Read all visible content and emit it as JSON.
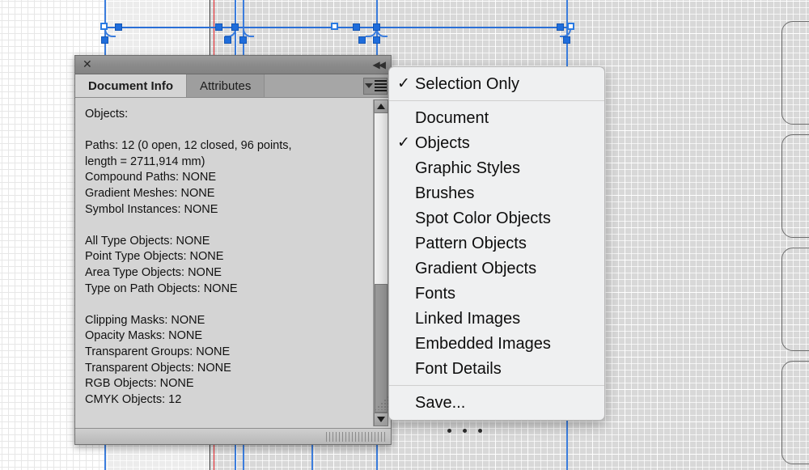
{
  "app": {
    "canvas_label": "illustrator-artboard"
  },
  "panel": {
    "title_close_icon": "✕",
    "collapse_icon": "◀◀",
    "tabs": [
      {
        "label": "Document Info",
        "active": true
      },
      {
        "label": "Attributes",
        "active": false
      }
    ],
    "menu_button_name": "panel-menu-icon",
    "info_text": "Objects:\n\nPaths: 12 (0 open, 12 closed, 96 points,\nlength = 2711,914 mm)\nCompound Paths: NONE\nGradient Meshes: NONE\nSymbol Instances: NONE\n\nAll Type Objects: NONE\nPoint Type Objects: NONE\nArea Type Objects: NONE\nType on Path Objects: NONE\n\nClipping Masks: NONE\nOpacity Masks: NONE\nTransparent Groups: NONE\nTransparent Objects: NONE\nRGB Objects: NONE\nCMYK Objects: 12",
    "scroll": {
      "up_arrow": "▲",
      "down_arrow": "▼"
    }
  },
  "menu": {
    "groups": [
      {
        "items": [
          {
            "label": "Selection Only",
            "checked": true
          }
        ]
      },
      {
        "items": [
          {
            "label": "Document",
            "checked": false
          },
          {
            "label": "Objects",
            "checked": true
          },
          {
            "label": "Graphic Styles",
            "checked": false
          },
          {
            "label": "Brushes",
            "checked": false
          },
          {
            "label": "Spot Color Objects",
            "checked": false
          },
          {
            "label": "Pattern Objects",
            "checked": false
          },
          {
            "label": "Gradient Objects",
            "checked": false
          },
          {
            "label": "Fonts",
            "checked": false
          },
          {
            "label": "Linked Images",
            "checked": false
          },
          {
            "label": "Embedded Images",
            "checked": false
          },
          {
            "label": "Font Details",
            "checked": false
          }
        ]
      },
      {
        "items": [
          {
            "label": "Save...",
            "checked": false
          }
        ]
      }
    ],
    "check_glyph": "✓",
    "more_indicator": "menu-more-dots"
  },
  "colors": {
    "selection_blue": "#2a6fd6",
    "guide_red": "#e8262b",
    "guide_blue": "#3b7ddd",
    "panel_gray": "#d4d4d4",
    "menu_bg": "#eff0f1"
  }
}
